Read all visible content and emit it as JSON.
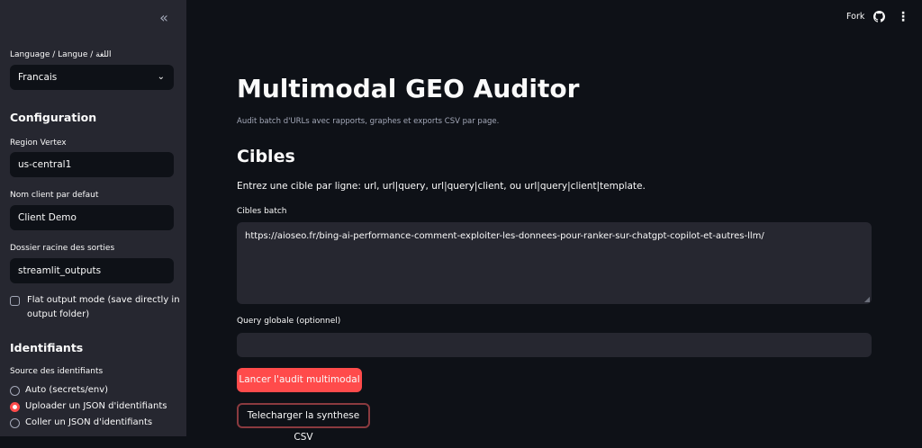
{
  "sidebar": {
    "collapse_icon": "chevrons-left-icon",
    "language_label": "Language / Langue / اللغة",
    "language_value": "Francais",
    "config_heading": "Configuration",
    "region_label": "Region Vertex",
    "region_value": "us-central1",
    "client_label": "Nom client par defaut",
    "client_value": "Client Demo",
    "output_label": "Dossier racine des sorties",
    "output_value": "streamlit_outputs",
    "flat_mode_label": "Flat output mode (save directly in output folder)",
    "flat_mode_checked": false,
    "ident_heading": "Identifiants",
    "ident_source_label": "Source des identifiants",
    "ident_options": [
      {
        "label": "Auto (secrets/env)",
        "selected": false
      },
      {
        "label": "Uploader un JSON d'identifiants",
        "selected": true
      },
      {
        "label": "Coller un JSON d'identifiants",
        "selected": false
      }
    ]
  },
  "topbar": {
    "fork_label": "Fork",
    "github_icon": "github-icon",
    "menu_icon": "more-vertical-icon"
  },
  "main": {
    "title": "Multimodal GEO Auditor",
    "subtitle": "Audit batch d'URLs avec rapports, graphes et exports CSV par page.",
    "section_heading": "Cibles",
    "instructions": "Entrez une cible par ligne: url, url|query, url|query|client, ou url|query|client|template.",
    "targets_label": "Cibles batch",
    "targets_value": "https://aioseo.fr/bing-ai-performance-comment-exploiter-les-donnees-pour-ranker-sur-chatgpt-copilot-et-autres-llm/",
    "query_label": "Query globale (optionnel)",
    "query_value": "",
    "run_button": "Lancer l'audit multimodal",
    "download_button": "Telecharger la synthese CSV"
  },
  "colors": {
    "background": "#0e1117",
    "sidebar": "#262730",
    "accent": "#ff4b4b",
    "text": "#fafafa",
    "muted": "#a3a8b8"
  }
}
